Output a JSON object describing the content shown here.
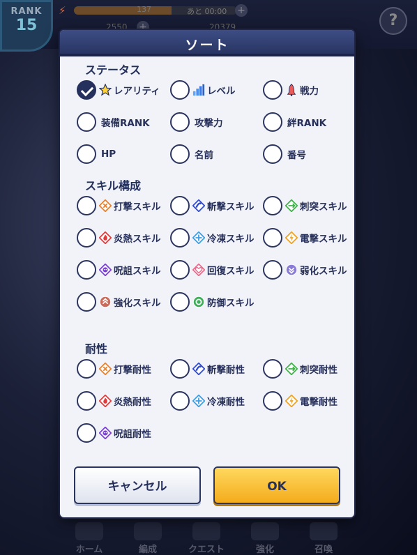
{
  "background": {
    "rank_label": "RANK",
    "rank_value": "15",
    "stamina_value": "137",
    "stamina_fill": 0.6,
    "recover_text": "あと 00:00",
    "coin1": "2550",
    "coin2": "20379",
    "nav": [
      "ホーム",
      "編成",
      "クエスト",
      "強化",
      "召喚"
    ]
  },
  "modal": {
    "title": "ソート",
    "sections": {
      "status": "ステータス",
      "skill": "スキル構成",
      "resist": "耐性"
    },
    "status_options": [
      {
        "label": "レアリティ",
        "icon": "star-icon",
        "checked": true
      },
      {
        "label": "レベル",
        "icon": "level-bars-icon",
        "checked": false
      },
      {
        "label": "戦力",
        "icon": "power-bell-icon",
        "checked": false
      },
      {
        "label": "装備RANK",
        "icon": "",
        "checked": false
      },
      {
        "label": "攻撃力",
        "icon": "",
        "checked": false
      },
      {
        "label": "絆RANK",
        "icon": "",
        "checked": false
      },
      {
        "label": "HP",
        "icon": "",
        "checked": false
      },
      {
        "label": "名前",
        "icon": "",
        "checked": false
      },
      {
        "label": "番号",
        "icon": "",
        "checked": false
      }
    ],
    "skill_options": [
      {
        "label": "打撃スキル",
        "icon": "strike-icon",
        "color": "#e8812a"
      },
      {
        "label": "斬撃スキル",
        "icon": "slash-icon",
        "color": "#2f4bd3"
      },
      {
        "label": "刺突スキル",
        "icon": "pierce-icon",
        "color": "#3fb24a"
      },
      {
        "label": "炎熱スキル",
        "icon": "fire-icon",
        "color": "#e23b3b"
      },
      {
        "label": "冷凍スキル",
        "icon": "ice-icon",
        "color": "#3a9ee6"
      },
      {
        "label": "電撃スキル",
        "icon": "thunder-icon",
        "color": "#f0a321"
      },
      {
        "label": "呪詛スキル",
        "icon": "curse-icon",
        "color": "#7b3fd6"
      },
      {
        "label": "回復スキル",
        "icon": "heal-icon",
        "color": "#ec6b8c"
      },
      {
        "label": "弱化スキル",
        "icon": "debuff-icon",
        "color": "#8a7bd8"
      },
      {
        "label": "強化スキル",
        "icon": "buff-icon",
        "color": "#c96a5a"
      },
      {
        "label": "防御スキル",
        "icon": "defense-icon",
        "color": "#3fae5a"
      }
    ],
    "resist_options": [
      {
        "label": "打撃耐性",
        "icon": "strike-icon",
        "color": "#e8812a"
      },
      {
        "label": "斬撃耐性",
        "icon": "slash-icon",
        "color": "#2f4bd3"
      },
      {
        "label": "刺突耐性",
        "icon": "pierce-icon",
        "color": "#3fb24a"
      },
      {
        "label": "炎熱耐性",
        "icon": "fire-icon",
        "color": "#e23b3b"
      },
      {
        "label": "冷凍耐性",
        "icon": "ice-icon",
        "color": "#3a9ee6"
      },
      {
        "label": "電撃耐性",
        "icon": "thunder-icon",
        "color": "#f0a321"
      },
      {
        "label": "呪詛耐性",
        "icon": "curse-icon",
        "color": "#7b3fd6"
      }
    ],
    "cancel_label": "キャンセル",
    "ok_label": "OK"
  }
}
